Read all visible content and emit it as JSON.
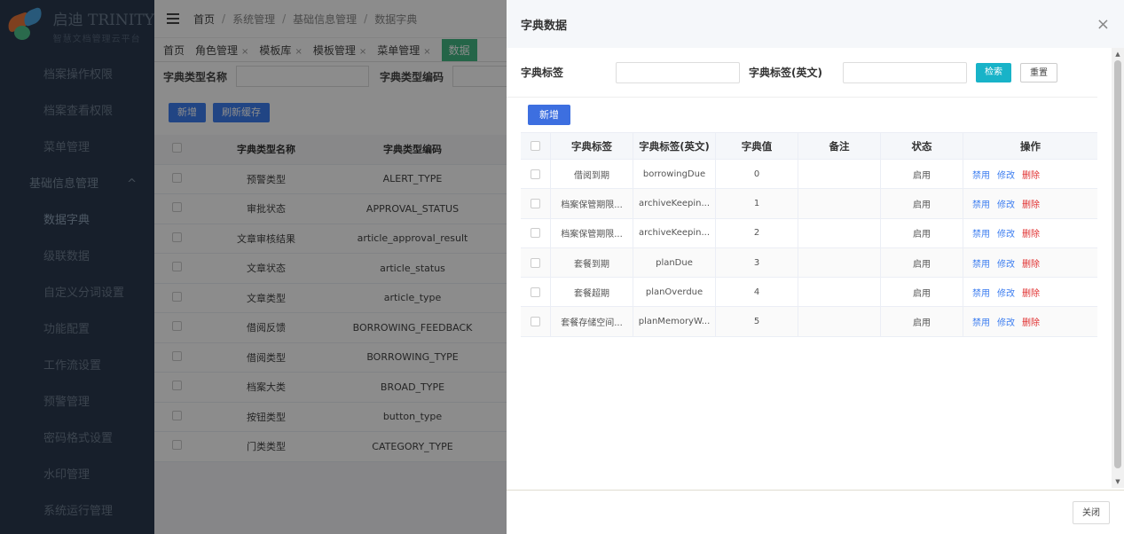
{
  "sidebar": {
    "logo_title": "启迪 TRINITY",
    "logo_subtitle": "智慧文档管理云平台",
    "items": [
      {
        "label": "档案操作权限"
      },
      {
        "label": "档案查看权限"
      },
      {
        "label": "菜单管理"
      },
      {
        "label": "基础信息管理",
        "group": true
      },
      {
        "label": "数据字典",
        "active": true
      },
      {
        "label": "级联数据"
      },
      {
        "label": "自定义分词设置"
      },
      {
        "label": "功能配置"
      },
      {
        "label": "工作流设置"
      },
      {
        "label": "预警管理"
      },
      {
        "label": "密码格式设置"
      },
      {
        "label": "水印管理"
      },
      {
        "label": "系统运行管理"
      }
    ],
    "group_chevron": "^"
  },
  "breadcrumb": [
    "首页",
    "系统管理",
    "基础信息管理",
    "数据字典"
  ],
  "tabs": [
    {
      "label": "首页",
      "closable": false
    },
    {
      "label": "角色管理",
      "closable": true
    },
    {
      "label": "模板库",
      "closable": true
    },
    {
      "label": "模板管理",
      "closable": true
    },
    {
      "label": "菜单管理",
      "closable": true
    },
    {
      "label": "数据",
      "closable": false,
      "active": true
    }
  ],
  "search": {
    "type_name_label": "字典类型名称",
    "type_code_label": "字典类型编码"
  },
  "buttons": {
    "add": "新增",
    "refresh_cache": "刷新缓存"
  },
  "main_table": {
    "headers": [
      "字典类型名称",
      "字典类型编码"
    ],
    "rows": [
      [
        "预警类型",
        "ALERT_TYPE"
      ],
      [
        "审批状态",
        "APPROVAL_STATUS"
      ],
      [
        "文章审核结果",
        "article_approval_result"
      ],
      [
        "文章状态",
        "article_status"
      ],
      [
        "文章类型",
        "article_type"
      ],
      [
        "借阅反馈",
        "BORROWING_FEEDBACK"
      ],
      [
        "借阅类型",
        "BORROWING_TYPE"
      ],
      [
        "档案大类",
        "BROAD_TYPE"
      ],
      [
        "按钮类型",
        "button_type"
      ],
      [
        "门类类型",
        "CATEGORY_TYPE"
      ]
    ]
  },
  "drawer": {
    "title": "字典数据",
    "close_icon": "×",
    "filter": {
      "label_cn": "字典标签",
      "label_en": "字典标签(英文)",
      "search_btn": "检索",
      "reset_btn": "重置"
    },
    "add_btn": "新增",
    "table": {
      "headers": [
        "字典标签",
        "字典标签(英文)",
        "字典值",
        "备注",
        "状态",
        "操作"
      ],
      "rows": [
        {
          "label": "借阅到期",
          "label_en": "borrowingDue",
          "value": "0",
          "remark": "",
          "status": "启用"
        },
        {
          "label": "档案保管期限...",
          "label_en": "archiveKeepin...",
          "value": "1",
          "remark": "",
          "status": "启用"
        },
        {
          "label": "档案保管期限...",
          "label_en": "archiveKeepin...",
          "value": "2",
          "remark": "",
          "status": "启用"
        },
        {
          "label": "套餐到期",
          "label_en": "planDue",
          "value": "3",
          "remark": "",
          "status": "启用"
        },
        {
          "label": "套餐超期",
          "label_en": "planOverdue",
          "value": "4",
          "remark": "",
          "status": "启用"
        },
        {
          "label": "套餐存储空间...",
          "label_en": "planMemoryW...",
          "value": "5",
          "remark": "",
          "status": "启用"
        }
      ],
      "ops": {
        "disable": "禁用",
        "edit": "修改",
        "delete": "删除"
      }
    },
    "footer_close": "关闭"
  },
  "colors": {
    "sidebar_bg": "#2b3a4f",
    "primary": "#3d7ef0",
    "search_btn": "#18b3c8",
    "delete": "#e03030"
  }
}
